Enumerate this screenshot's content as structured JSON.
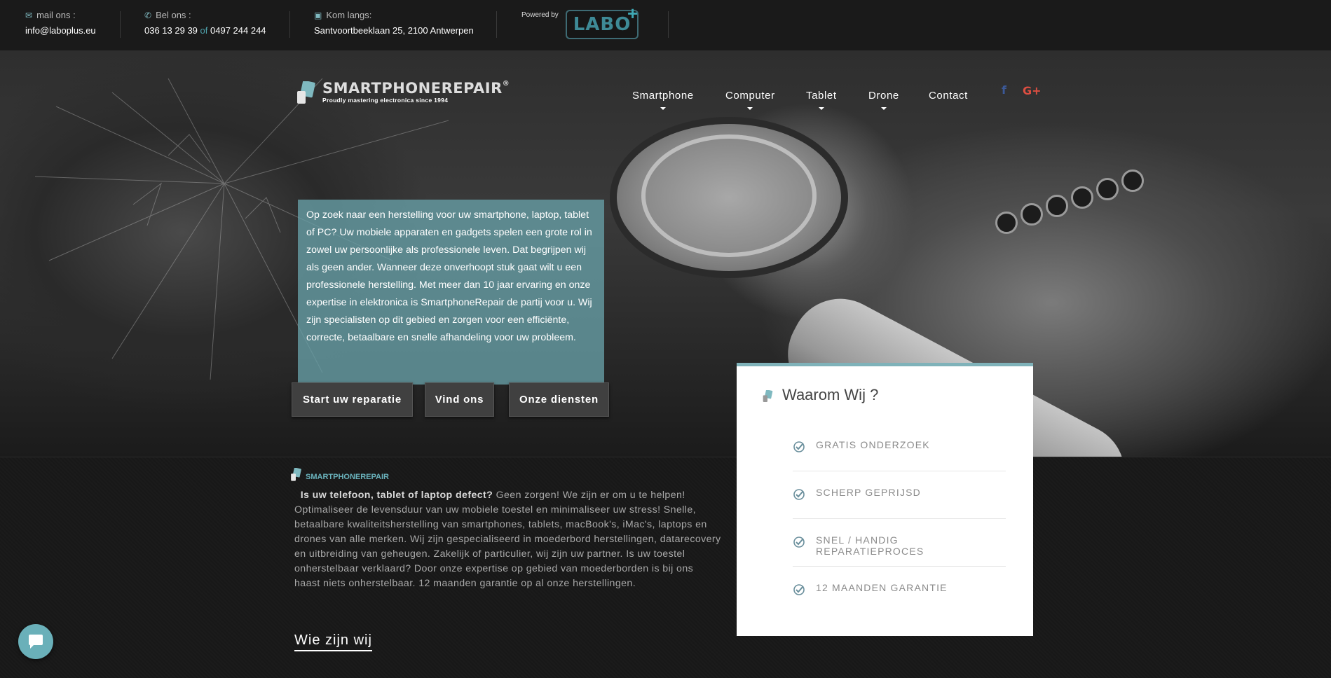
{
  "topbar": {
    "mail_label": "mail ons :",
    "mail_value": "info@laboplus.eu",
    "phone_label": "Bel ons :",
    "phone_value_1": "036 13 29 39",
    "phone_of": "of",
    "phone_value_2": "0497 244 244",
    "address_label": "Kom langs:",
    "address_value": "Santvoortbeeklaan 25, 2100 Antwerpen",
    "powered_by": "Powered by",
    "partner_logo": "LABO",
    "partner_logo_plus": "+"
  },
  "logo": {
    "title": "SMARTPHONEREPAIR",
    "registered": "®",
    "subtitle": "Proudly mastering electronica since 1994"
  },
  "nav": {
    "items": [
      {
        "label": "Smartphone",
        "dropdown": true
      },
      {
        "label": "Computer",
        "dropdown": true
      },
      {
        "label": "Tablet",
        "dropdown": true
      },
      {
        "label": "Drone",
        "dropdown": true
      },
      {
        "label": "Contact",
        "dropdown": false
      }
    ],
    "social": {
      "facebook": "f",
      "googleplus": "G+"
    }
  },
  "hero": {
    "intro": "Op zoek naar een herstelling voor uw smartphone, laptop, tablet of PC? Uw mobiele apparaten en gadgets spelen een grote rol in zowel uw persoonlijke als professionele leven. Dat begrijpen wij als geen ander. Wanneer deze onverhoopt stuk gaat wilt u een professionele herstelling. Met meer dan 10 jaar ervaring en onze expertise in elektronica is SmartphoneRepair de partij voor u. Wij zijn specialisten op dit gebied en zorgen voor een efficiënte, correcte, betaalbare en snelle afhandeling voor uw probleem.",
    "buttons": {
      "start": "Start uw reparatie",
      "find": "Vind ons",
      "services": "Onze diensten"
    }
  },
  "about": {
    "tag": "SMARTPHONEREPAIR",
    "lead": "Is uw telefoon, tablet of laptop defect?",
    "body": " Geen zorgen! We zijn er om u te helpen! Optimaliseer de levensduur van uw mobiele toestel en minimaliseer uw stress! Snelle, betaalbare kwaliteitsherstelling van smartphones, tablets, macBook's, iMac's, laptops en drones van alle merken. Wij zijn gespecialiseerd in moederbord herstellingen, datarecovery en uitbreiding van geheugen. Zakelijk of particulier, wij zijn uw partner. Is uw toestel onherstelbaar verklaard? Door onze expertise op gebied van moederborden is bij ons haast niets onherstelbaar. 12 maanden garantie op al onze herstellingen.",
    "link": "Wie zijn wij"
  },
  "waarom": {
    "title": "Waarom Wij ?",
    "items": [
      "GRATIS ONDERZOEK",
      "SCHERP GEPRIJSD",
      "SNEL / HANDIG REPARATIEPROCES",
      "12 MAANDEN GARANTIE"
    ]
  },
  "colors": {
    "accent": "#6ab0b9",
    "intro_box": "#68a0a8",
    "topbar": "#1a1a1a",
    "button": "#404040"
  }
}
